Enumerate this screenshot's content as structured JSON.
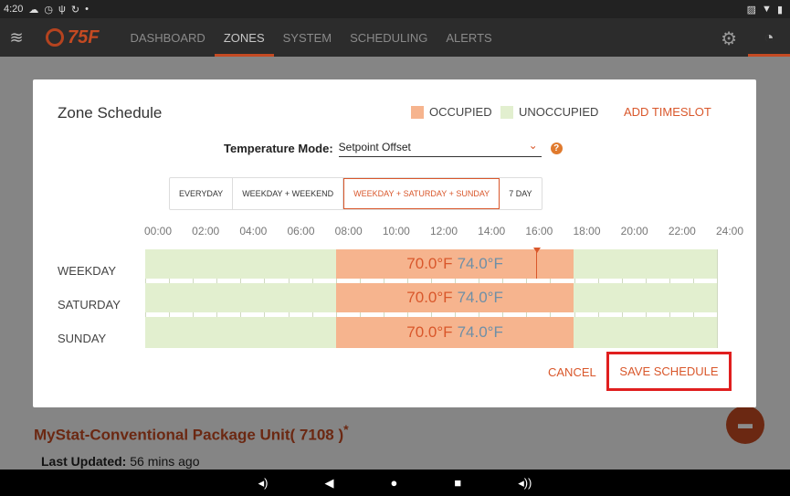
{
  "status_bar": {
    "time": "4:20",
    "icons": [
      "cloud-icon",
      "clock-icon",
      "usb-icon",
      "sync-icon",
      "dot-icon"
    ],
    "right_icons": [
      "signal-icon",
      "wifi-icon",
      "battery-icon"
    ]
  },
  "nav": {
    "logo_text": "75F",
    "tabs": [
      {
        "label": "DASHBOARD"
      },
      {
        "label": "ZONES"
      },
      {
        "label": "SYSTEM"
      },
      {
        "label": "SCHEDULING"
      },
      {
        "label": "ALERTS"
      }
    ],
    "active_tab": "ZONES"
  },
  "background": {
    "unit_title": "MyStat-Conventional Package Unit( 7108 )",
    "unit_title_suffix": "*",
    "last_updated_label": "Last Updated:",
    "last_updated_value": "56 mins ago"
  },
  "dialog": {
    "title": "Zone Schedule",
    "legend": {
      "occupied": "OCCUPIED",
      "unoccupied": "UNOCCUPIED",
      "occupied_color": "#f6b48e",
      "unoccupied_color": "#e2efcf"
    },
    "add_timeslot": "ADD TIMESLOT",
    "temperature_mode_label": "Temperature Mode:",
    "temperature_mode_value": "Setpoint Offset",
    "schedule_types": [
      {
        "label": "EVERYDAY"
      },
      {
        "label": "WEEKDAY + WEEKEND"
      },
      {
        "label": "WEEKDAY + SATURDAY + SUNDAY"
      },
      {
        "label": "7 DAY"
      }
    ],
    "active_schedule_type": "WEEKDAY + SATURDAY + SUNDAY",
    "hours": [
      "00:00",
      "02:00",
      "04:00",
      "06:00",
      "08:00",
      "10:00",
      "12:00",
      "14:00",
      "16:00",
      "18:00",
      "20:00",
      "22:00",
      "24:00"
    ],
    "days": [
      {
        "label": "WEEKDAY",
        "start": "08:00",
        "end": "18:00",
        "heat": "70.0°F",
        "cool": "74.0°F"
      },
      {
        "label": "SATURDAY",
        "start": "08:00",
        "end": "18:00",
        "heat": "70.0°F",
        "cool": "74.0°F"
      },
      {
        "label": "SUNDAY",
        "start": "08:00",
        "end": "18:00",
        "heat": "70.0°F",
        "cool": "74.0°F"
      }
    ],
    "cancel_label": "CANCEL",
    "save_label": "SAVE SCHEDULE"
  }
}
